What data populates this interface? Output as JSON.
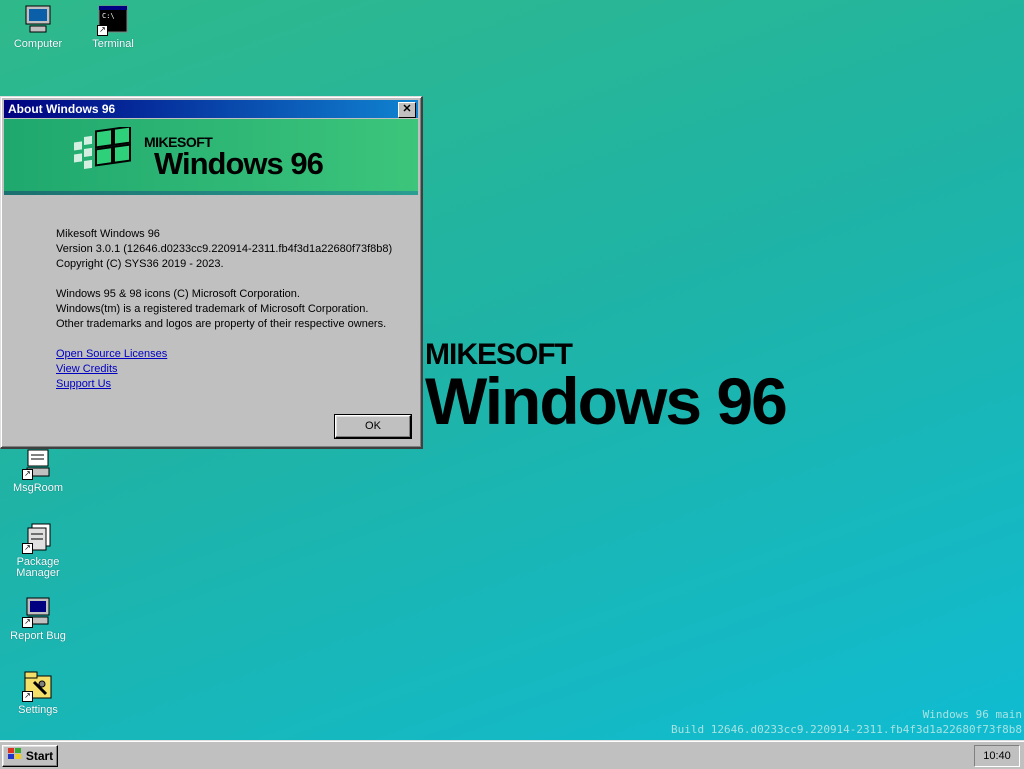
{
  "desktop": {
    "icons": [
      {
        "label": "Computer",
        "icon": "computer-icon"
      },
      {
        "label": "Terminal",
        "icon": "terminal-icon"
      },
      {
        "label": "MsgRoom",
        "icon": "msgroom-icon"
      },
      {
        "label": "Package Manager",
        "icon": "package-icon"
      },
      {
        "label": "Report Bug",
        "icon": "report-bug-icon"
      },
      {
        "label": "Settings",
        "icon": "settings-icon"
      }
    ],
    "wallpaper": {
      "brand_line1": "MIKESOFT",
      "brand_line2": "Windows 96"
    },
    "watermark": {
      "line1": "Windows 96 main",
      "line2": "Build 12646.d0233cc9.220914-2311.fb4f3d1a22680f73f8b8"
    }
  },
  "about_window": {
    "title": "About Windows 96",
    "banner": {
      "brand_line1": "MIKESOFT",
      "brand_line2": "Windows 96"
    },
    "info": [
      "Mikesoft Windows 96",
      "Version 3.0.1 (12646.d0233cc9.220914-2311.fb4f3d1a22680f73f8b8)",
      "Copyright (C) SYS36 2019 - 2023."
    ],
    "legal": [
      "Windows 95 & 98 icons (C) Microsoft Corporation.",
      "Windows(tm) is a registered trademark of Microsoft Corporation.",
      "Other trademarks and logos are property of their respective owners."
    ],
    "links": [
      "Open Source Licenses",
      "View Credits",
      "Support Us"
    ],
    "ok_label": "OK",
    "close_label": "✕"
  },
  "taskbar": {
    "start_label": "Start",
    "clock": "10:40"
  },
  "colors": {
    "title_start": "#000080",
    "title_end": "#1084d0",
    "banner": "#3cc57b",
    "link": "#0000c0"
  }
}
